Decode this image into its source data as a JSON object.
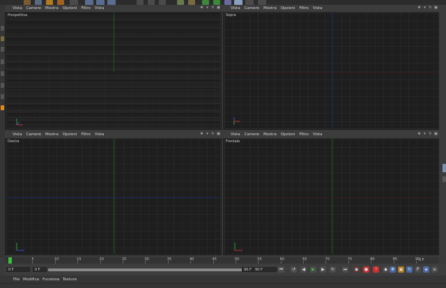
{
  "viewport_menu": [
    "Vista",
    "Camere",
    "Mostra",
    "Opzioni",
    "Filtro",
    "Vista"
  ],
  "viewports": [
    {
      "label": "Prospettiva"
    },
    {
      "label": "Sopra"
    },
    {
      "label": "Destra"
    },
    {
      "label": "Frontale"
    }
  ],
  "timeline": {
    "ticks": [
      "0",
      "5",
      "10",
      "15",
      "20",
      "25",
      "30",
      "35",
      "40",
      "45",
      "50",
      "55",
      "60",
      "65",
      "70",
      "75",
      "80",
      "85",
      "90"
    ],
    "current_frame": "0 F",
    "start_field": "0 F",
    "range_start": "0 F",
    "range_end": "90 F",
    "end_field": "90 F"
  },
  "bottom_menu": [
    "File",
    "Modifica",
    "Funzione",
    "Texture"
  ],
  "colors": {
    "axis_green": "#1f5a1f",
    "axis_blue": "#1d2a66",
    "play_green": "#3bbf3b",
    "record_red": "#c83030",
    "accent_orange": "#e08a1e"
  }
}
